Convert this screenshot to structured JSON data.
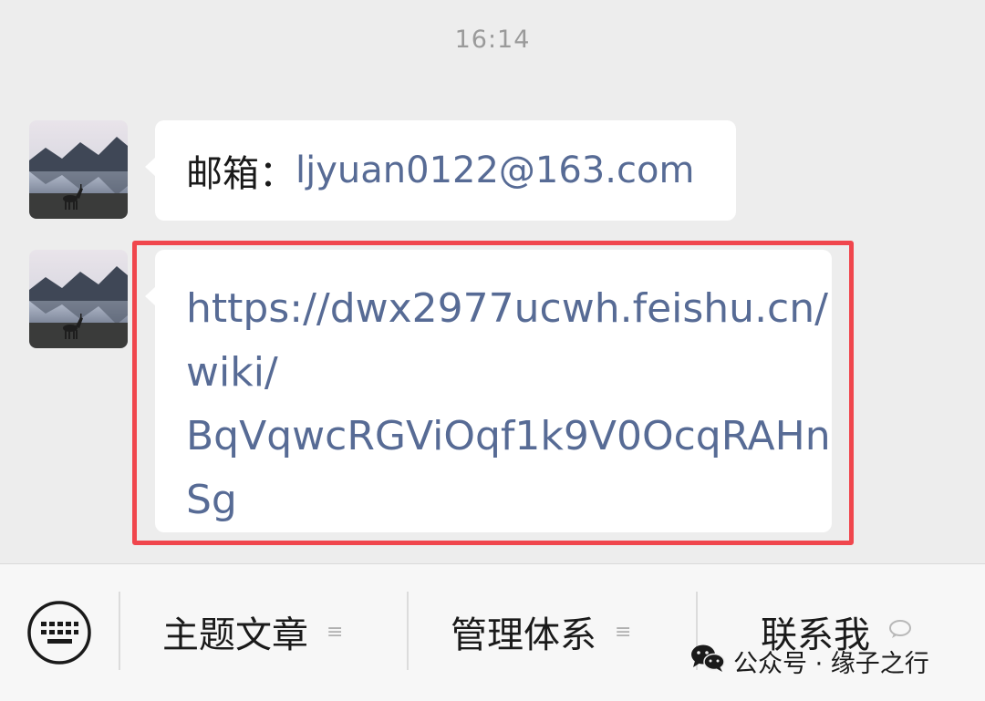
{
  "chat": {
    "timestamp": "16:14",
    "messages": [
      {
        "label": "邮箱：",
        "email": "ljyuan0122@163.com"
      },
      {
        "lines": [
          "https://dwx2977ucwh.feishu.cn/",
          "wiki/",
          "BqVqwcRGViOqf1k9V0OcqRAHn",
          "Sg"
        ]
      }
    ]
  },
  "bottom_menu": {
    "keyboard_icon": "keyboard-icon",
    "items": [
      {
        "label": "主题文章",
        "icon": "menu-list-icon"
      },
      {
        "label": "管理体系",
        "icon": "menu-list-icon"
      },
      {
        "label": "联系我",
        "icon": "chat-bubble-icon"
      }
    ]
  },
  "watermark": {
    "text": "公众号 · 缘子之行",
    "icon": "wechat-icon"
  },
  "colors": {
    "link": "#576b95",
    "highlight": "#f0464d",
    "background": "#ededed"
  }
}
